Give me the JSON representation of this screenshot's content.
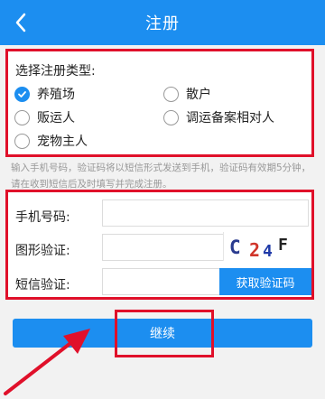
{
  "header": {
    "title": "注册",
    "back_icon": "chevron-left-icon",
    "background": "#1c8ef0"
  },
  "registration_type": {
    "heading": "选择注册类型:",
    "options": [
      {
        "label": "养殖场",
        "checked": true
      },
      {
        "label": "散户",
        "checked": false
      },
      {
        "label": "贩运人",
        "checked": false
      },
      {
        "label": "调运备案相对人",
        "checked": false
      },
      {
        "label": "宠物主人",
        "checked": false
      }
    ]
  },
  "notice": "输入手机号码，验证码将以短信形式发送到手机，验证码有效期5分钟，请在收到短信后及时填写并完成注册。",
  "form": {
    "phone_label": "手机号码:",
    "phone_value": "",
    "captcha_label": "图形验证:",
    "captcha_value": "",
    "captcha_text": "C24F",
    "sms_label": "短信验证:",
    "sms_value": "",
    "sms_button": "获取验证码"
  },
  "continue_button": "继续",
  "colors": {
    "accent": "#1c8ef0",
    "annotation_red": "#e0102a",
    "background": "#f2f2f2"
  }
}
